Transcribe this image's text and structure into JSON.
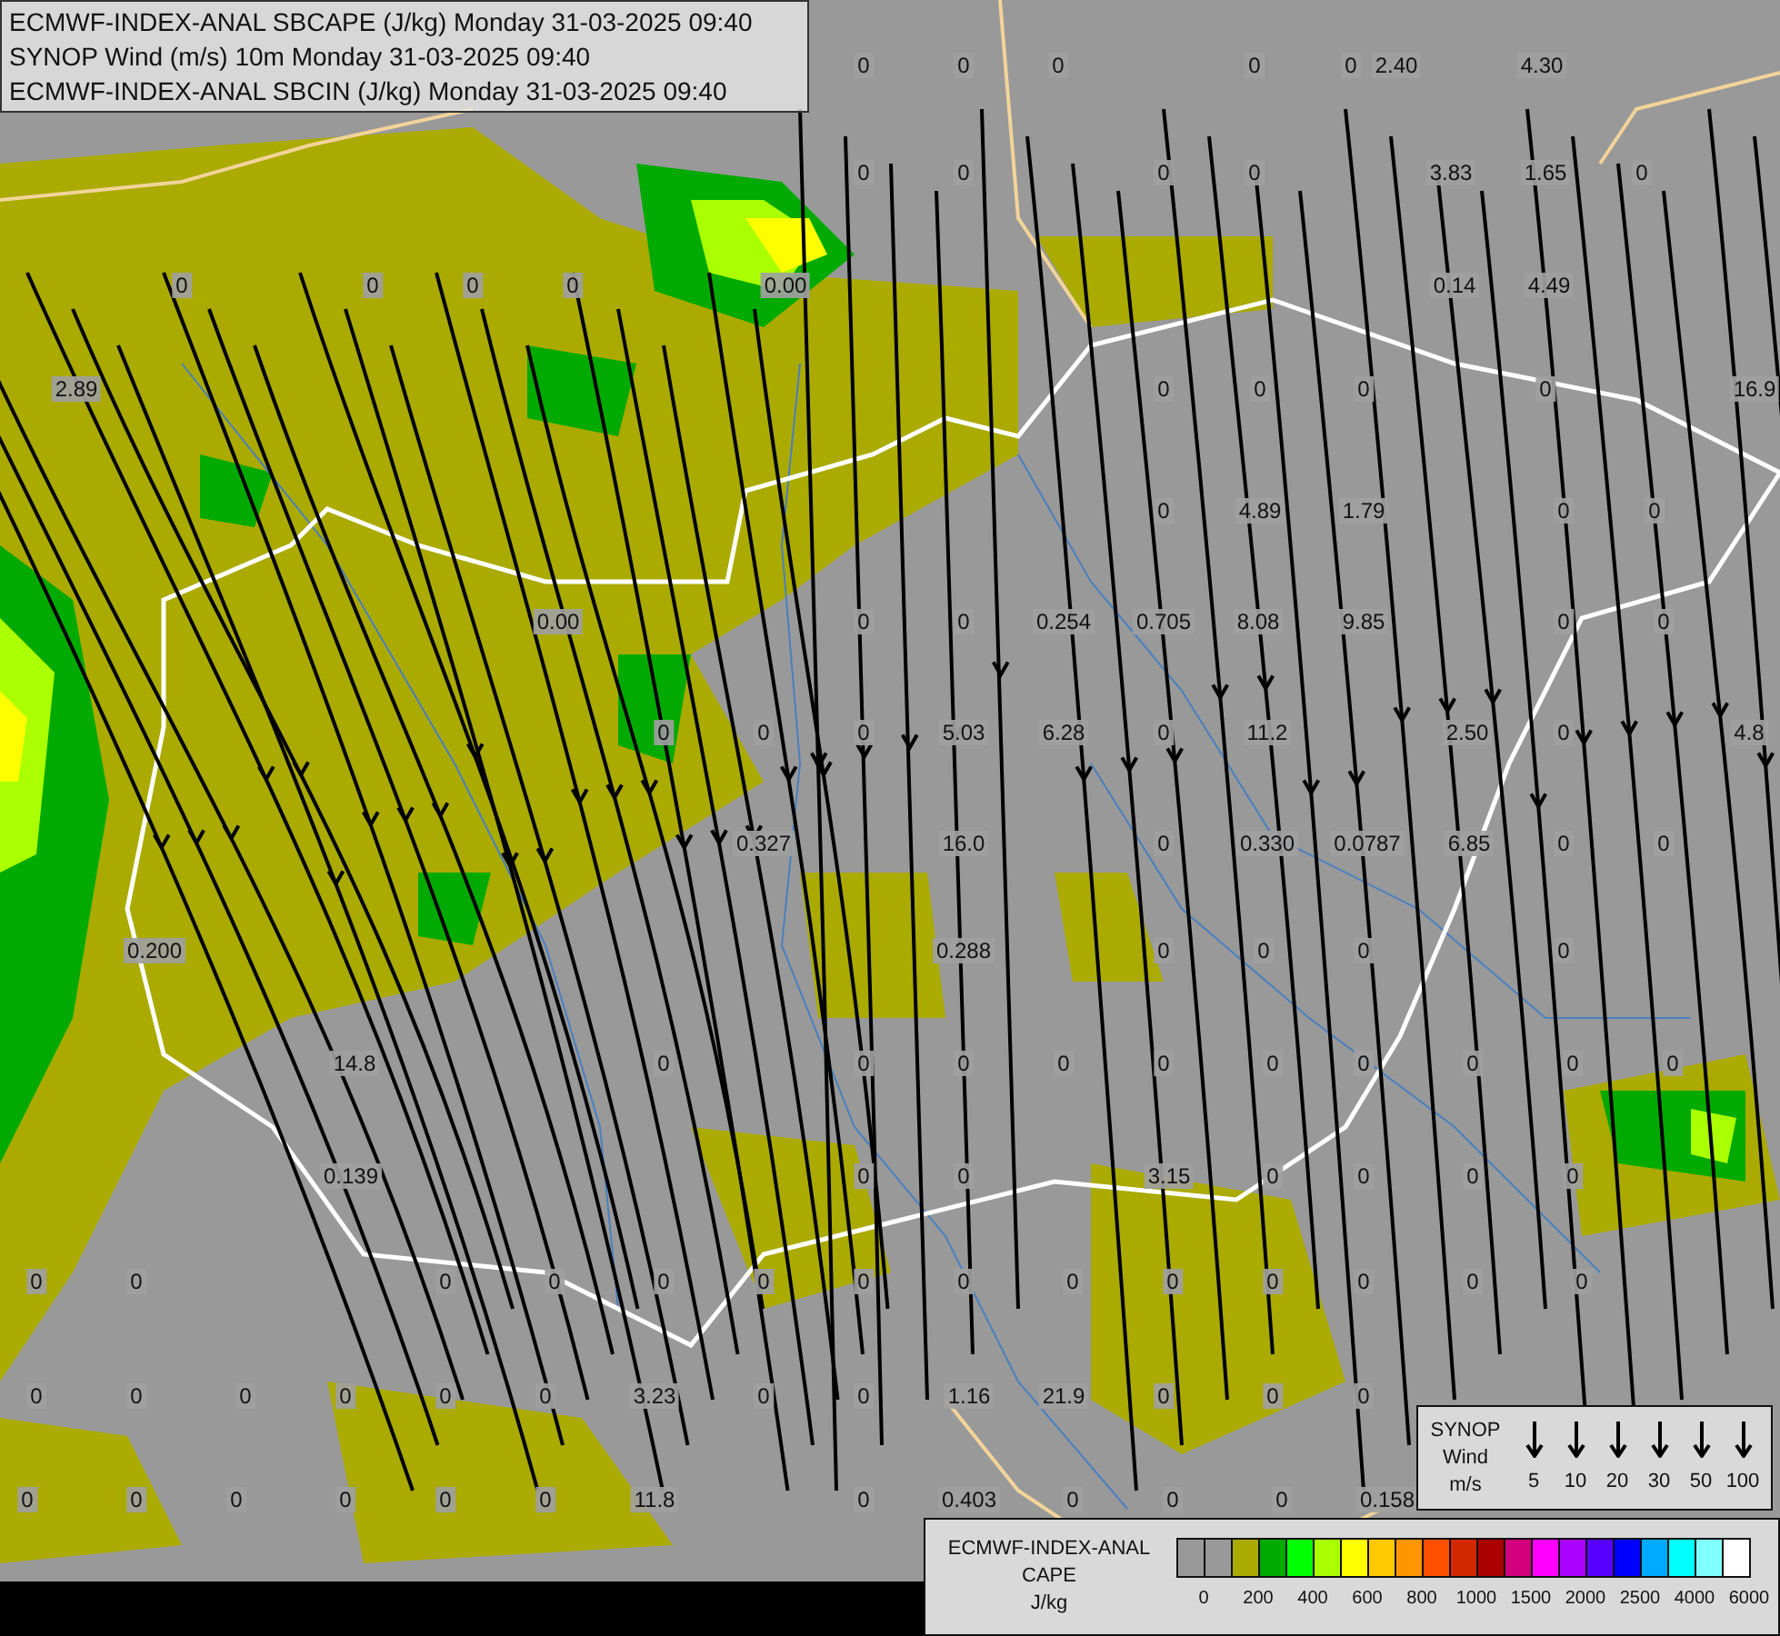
{
  "title_box": {
    "lines": [
      "ECMWF-INDEX-ANAL SBCAPE (J/kg) Monday 31-03-2025 09:40",
      "SYNOP Wind (m/s) 10m Monday 31-03-2025 09:40",
      "ECMWF-INDEX-ANAL SBCIN (J/kg) Monday 31-03-2025 09:40"
    ]
  },
  "map": {
    "labels": [
      {
        "text": "0"
      },
      {
        "text": "0"
      },
      {
        "text": "0"
      },
      {
        "text": "0"
      },
      {
        "text": "0"
      },
      {
        "text": "2.40"
      },
      {
        "text": "4.30"
      },
      {
        "text": "0"
      },
      {
        "text": "0"
      },
      {
        "text": "0"
      },
      {
        "text": "0"
      },
      {
        "text": "3.83"
      },
      {
        "text": "1.65"
      },
      {
        "text": "0"
      },
      {
        "text": "0"
      },
      {
        "text": "0"
      },
      {
        "text": "0"
      },
      {
        "text": "0"
      },
      {
        "text": "0.00"
      },
      {
        "text": "0.14"
      },
      {
        "text": "4.49"
      },
      {
        "text": "2.89"
      },
      {
        "text": "0"
      },
      {
        "text": "0"
      },
      {
        "text": "0"
      },
      {
        "text": "0"
      },
      {
        "text": "16.9"
      },
      {
        "text": "0"
      },
      {
        "text": "4.89"
      },
      {
        "text": "1.79"
      },
      {
        "text": "0"
      },
      {
        "text": "0"
      },
      {
        "text": "0.00"
      },
      {
        "text": "0"
      },
      {
        "text": "0"
      },
      {
        "text": "0.254"
      },
      {
        "text": "0.705"
      },
      {
        "text": "8.08"
      },
      {
        "text": "9.85"
      },
      {
        "text": "0"
      },
      {
        "text": "0"
      },
      {
        "text": "0"
      },
      {
        "text": "0"
      },
      {
        "text": "0"
      },
      {
        "text": "5.03"
      },
      {
        "text": "6.28"
      },
      {
        "text": "0"
      },
      {
        "text": "11.2"
      },
      {
        "text": "2.50"
      },
      {
        "text": "0"
      },
      {
        "text": "4.8"
      },
      {
        "text": "0.327"
      },
      {
        "text": "16.0"
      },
      {
        "text": "0"
      },
      {
        "text": "0.330"
      },
      {
        "text": "0.0787"
      },
      {
        "text": "6.85"
      },
      {
        "text": "0"
      },
      {
        "text": "0"
      },
      {
        "text": "0.200"
      },
      {
        "text": "0.288"
      },
      {
        "text": "0"
      },
      {
        "text": "0"
      },
      {
        "text": "0"
      },
      {
        "text": "0"
      },
      {
        "text": "14.8"
      },
      {
        "text": "0"
      },
      {
        "text": "0"
      },
      {
        "text": "0"
      },
      {
        "text": "0"
      },
      {
        "text": "0"
      },
      {
        "text": "0"
      },
      {
        "text": "0"
      },
      {
        "text": "0"
      },
      {
        "text": "0"
      },
      {
        "text": "0"
      },
      {
        "text": "0.139"
      },
      {
        "text": "0"
      },
      {
        "text": "0"
      },
      {
        "text": "3.15"
      },
      {
        "text": "0"
      },
      {
        "text": "0"
      },
      {
        "text": "0"
      },
      {
        "text": "0"
      },
      {
        "text": "0"
      },
      {
        "text": "0"
      },
      {
        "text": "0"
      },
      {
        "text": "0"
      },
      {
        "text": "0"
      },
      {
        "text": "0"
      },
      {
        "text": "0"
      },
      {
        "text": "0"
      },
      {
        "text": "0"
      },
      {
        "text": "0"
      },
      {
        "text": "0"
      },
      {
        "text": "0"
      },
      {
        "text": "0"
      },
      {
        "text": "0"
      },
      {
        "text": "0"
      },
      {
        "text": "0"
      },
      {
        "text": "0"
      },
      {
        "text": "0"
      },
      {
        "text": "0"
      },
      {
        "text": "0"
      },
      {
        "text": "3.23"
      },
      {
        "text": "0"
      },
      {
        "text": "0"
      },
      {
        "text": "1.16"
      },
      {
        "text": "21.9"
      },
      {
        "text": "0"
      },
      {
        "text": "0"
      },
      {
        "text": "0"
      },
      {
        "text": "0"
      },
      {
        "text": "0"
      },
      {
        "text": "0"
      },
      {
        "text": "0"
      },
      {
        "text": "0"
      },
      {
        "text": "0"
      },
      {
        "text": "11.8"
      },
      {
        "text": "0"
      },
      {
        "text": "0.403"
      },
      {
        "text": "0"
      },
      {
        "text": "0"
      },
      {
        "text": "0"
      },
      {
        "text": "0.158"
      }
    ]
  },
  "wind_legend": {
    "title_lines": [
      "SYNOP",
      "Wind",
      "m/s"
    ],
    "speeds": [
      "5",
      "10",
      "20",
      "30",
      "50",
      "100"
    ]
  },
  "cape_legend": {
    "title_lines": [
      "ECMWF-INDEX-ANAL",
      "CAPE",
      "J/kg"
    ],
    "swatches": [
      {
        "color": "#999999"
      },
      {
        "color": "#999999"
      },
      {
        "color": "#aaaa00"
      },
      {
        "color": "#00aa00"
      },
      {
        "color": "#00ff00"
      },
      {
        "color": "#aaff00"
      },
      {
        "color": "#ffff00"
      },
      {
        "color": "#ffc800"
      },
      {
        "color": "#ff9600"
      },
      {
        "color": "#ff5000"
      },
      {
        "color": "#d22800"
      },
      {
        "color": "#aa0000"
      },
      {
        "color": "#d2007d"
      },
      {
        "color": "#ff00ff"
      },
      {
        "color": "#aa00ff"
      },
      {
        "color": "#5500ff"
      },
      {
        "color": "#0000ff"
      },
      {
        "color": "#00aaff"
      },
      {
        "color": "#00ffff"
      },
      {
        "color": "#80ffff"
      },
      {
        "color": "#ffffff"
      }
    ],
    "ticks": [
      "0",
      "200",
      "400",
      "600",
      "800",
      "1000",
      "1500",
      "2000",
      "2500",
      "4000",
      "6000"
    ]
  }
}
